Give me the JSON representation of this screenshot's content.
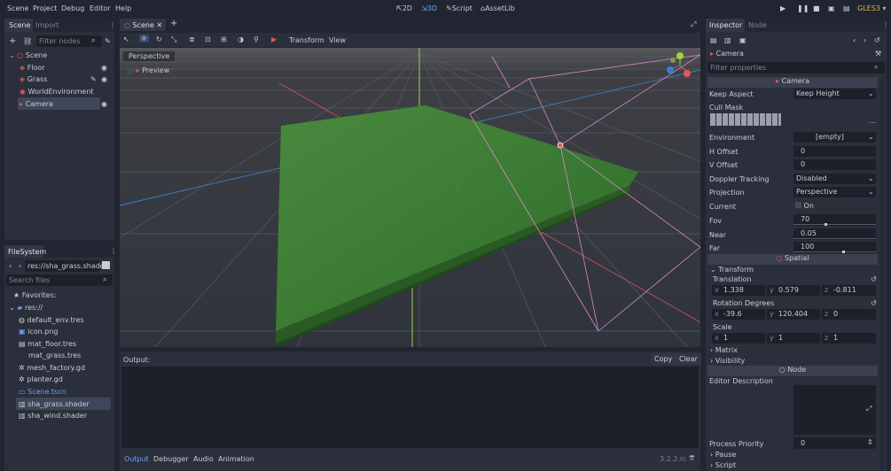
{
  "menu": {
    "scene": "Scene",
    "project": "Project",
    "debug": "Debug",
    "editor": "Editor",
    "help": "Help"
  },
  "workspaces": {
    "d2": "2D",
    "d3": "3D",
    "script": "Script",
    "assetlib": "AssetLib"
  },
  "renderer": "GLES3 ▾",
  "left": {
    "tabs": {
      "scene": "Scene",
      "import": "Import"
    },
    "filter_placeholder": "Filter nodes",
    "tree": [
      "Scene",
      "Floor",
      "Grass",
      "WorldEnvironment",
      "Camera"
    ]
  },
  "fs": {
    "tab": "FileSystem",
    "path": "res://sha_grass.shade",
    "search_placeholder": "Search files",
    "items": [
      "Favorites:",
      "res://",
      "default_env.tres",
      "icon.png",
      "mat_floor.tres",
      "mat_grass.tres",
      "mesh_factory.gd",
      "planter.gd",
      "Scene.tscn",
      "sha_grass.shader",
      "sha_wind.shader"
    ]
  },
  "center": {
    "tab": "Scene",
    "menus": {
      "transform": "Transform",
      "view": "View"
    },
    "viewport": {
      "perspective": "Perspective",
      "preview": "Preview"
    },
    "output": {
      "label": "Output:",
      "copy": "Copy",
      "clear": "Clear"
    },
    "bottom_tabs": [
      "Output",
      "Debugger",
      "Audio",
      "Animation"
    ],
    "version": "3.2.2.rc"
  },
  "inspector": {
    "tabs": {
      "inspector": "Inspector",
      "node": "Node"
    },
    "object": "Camera",
    "filter_placeholder": "Filter properties",
    "section_camera": "Camera",
    "props": {
      "keep_aspect": {
        "label": "Keep Aspect",
        "value": "Keep Height"
      },
      "cull_mask": {
        "label": "Cull Mask"
      },
      "environment": {
        "label": "Environment",
        "value": "[empty]"
      },
      "h_offset": {
        "label": "H Offset",
        "value": "0"
      },
      "v_offset": {
        "label": "V Offset",
        "value": "0"
      },
      "doppler": {
        "label": "Doppler Tracking",
        "value": "Disabled"
      },
      "projection": {
        "label": "Projection",
        "value": "Perspective"
      },
      "current": {
        "label": "Current",
        "value": "On"
      },
      "fov": {
        "label": "Fov",
        "value": "70"
      },
      "near": {
        "label": "Near",
        "value": "0.05"
      },
      "far": {
        "label": "Far",
        "value": "100"
      }
    },
    "section_spatial": "Spatial",
    "transform": {
      "label": "Transform",
      "translation": {
        "label": "Translation",
        "x": "1.338",
        "y": "0.579",
        "z": "-0.811"
      },
      "rotation": {
        "label": "Rotation Degrees",
        "x": "-39.6",
        "y": "120.404",
        "z": "0"
      },
      "scale": {
        "label": "Scale",
        "x": "1",
        "y": "1",
        "z": "1"
      }
    },
    "matrix": "Matrix",
    "visibility": "Visibility",
    "section_node": "Node",
    "editor_description": "Editor Description",
    "process_priority": {
      "label": "Process Priority",
      "value": "0"
    },
    "pause": "Pause",
    "script": "Script",
    "axis": {
      "x": "x",
      "y": "y",
      "z": "z"
    }
  },
  "colors": {
    "accent": "#6fa3f0",
    "bg": "#202531",
    "panel": "#2a2f3b",
    "grass": "#3a7a33",
    "red": "#e05a5a"
  }
}
